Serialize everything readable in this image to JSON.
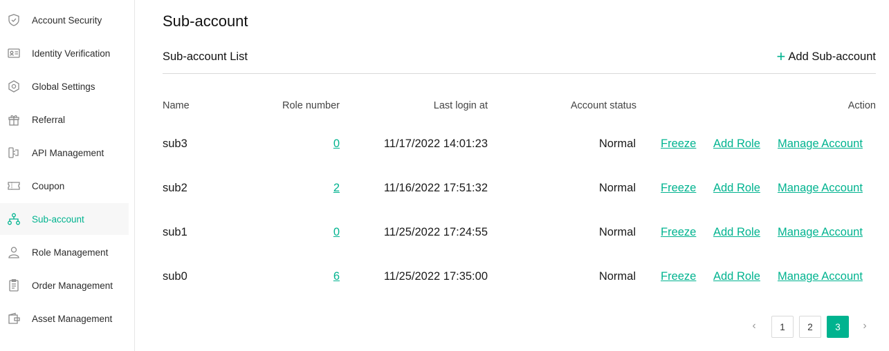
{
  "sidebar": {
    "items": [
      {
        "label": "Account Security",
        "icon": "shield-check-icon"
      },
      {
        "label": "Identity Verification",
        "icon": "id-card-icon"
      },
      {
        "label": "Global Settings",
        "icon": "settings-hexagon-icon"
      },
      {
        "label": "Referral",
        "icon": "gift-icon"
      },
      {
        "label": "API Management",
        "icon": "api-plug-icon"
      },
      {
        "label": "Coupon",
        "icon": "coupon-icon"
      },
      {
        "label": "Sub-account",
        "icon": "org-tree-icon",
        "active": true
      },
      {
        "label": "Role Management",
        "icon": "user-icon"
      },
      {
        "label": "Order Management",
        "icon": "clipboard-list-icon"
      },
      {
        "label": "Asset Management",
        "icon": "wallet-icon"
      }
    ]
  },
  "page": {
    "title": "Sub-account",
    "list_title": "Sub-account List",
    "add_label": "Add Sub-account"
  },
  "table": {
    "headers": {
      "name": "Name",
      "role_number": "Role number",
      "last_login": "Last login at",
      "status": "Account status",
      "action": "Action"
    },
    "actions": {
      "freeze": "Freeze",
      "add_role": "Add Role",
      "manage": "Manage Account"
    },
    "rows": [
      {
        "name": "sub3",
        "role_number": "0",
        "last_login": "11/17/2022 14:01:23",
        "status": "Normal"
      },
      {
        "name": "sub2",
        "role_number": "2",
        "last_login": "11/16/2022 17:51:32",
        "status": "Normal"
      },
      {
        "name": "sub1",
        "role_number": "0",
        "last_login": "11/25/2022 17:24:55",
        "status": "Normal"
      },
      {
        "name": "sub0",
        "role_number": "6",
        "last_login": "11/25/2022 17:35:00",
        "status": "Normal"
      }
    ]
  },
  "pagination": {
    "pages": [
      "1",
      "2",
      "3"
    ],
    "current": "3",
    "prev": "‹",
    "next": "›"
  },
  "colors": {
    "accent": "#00b38f",
    "text": "#1a1a1a",
    "divider": "#d9d9d9"
  }
}
